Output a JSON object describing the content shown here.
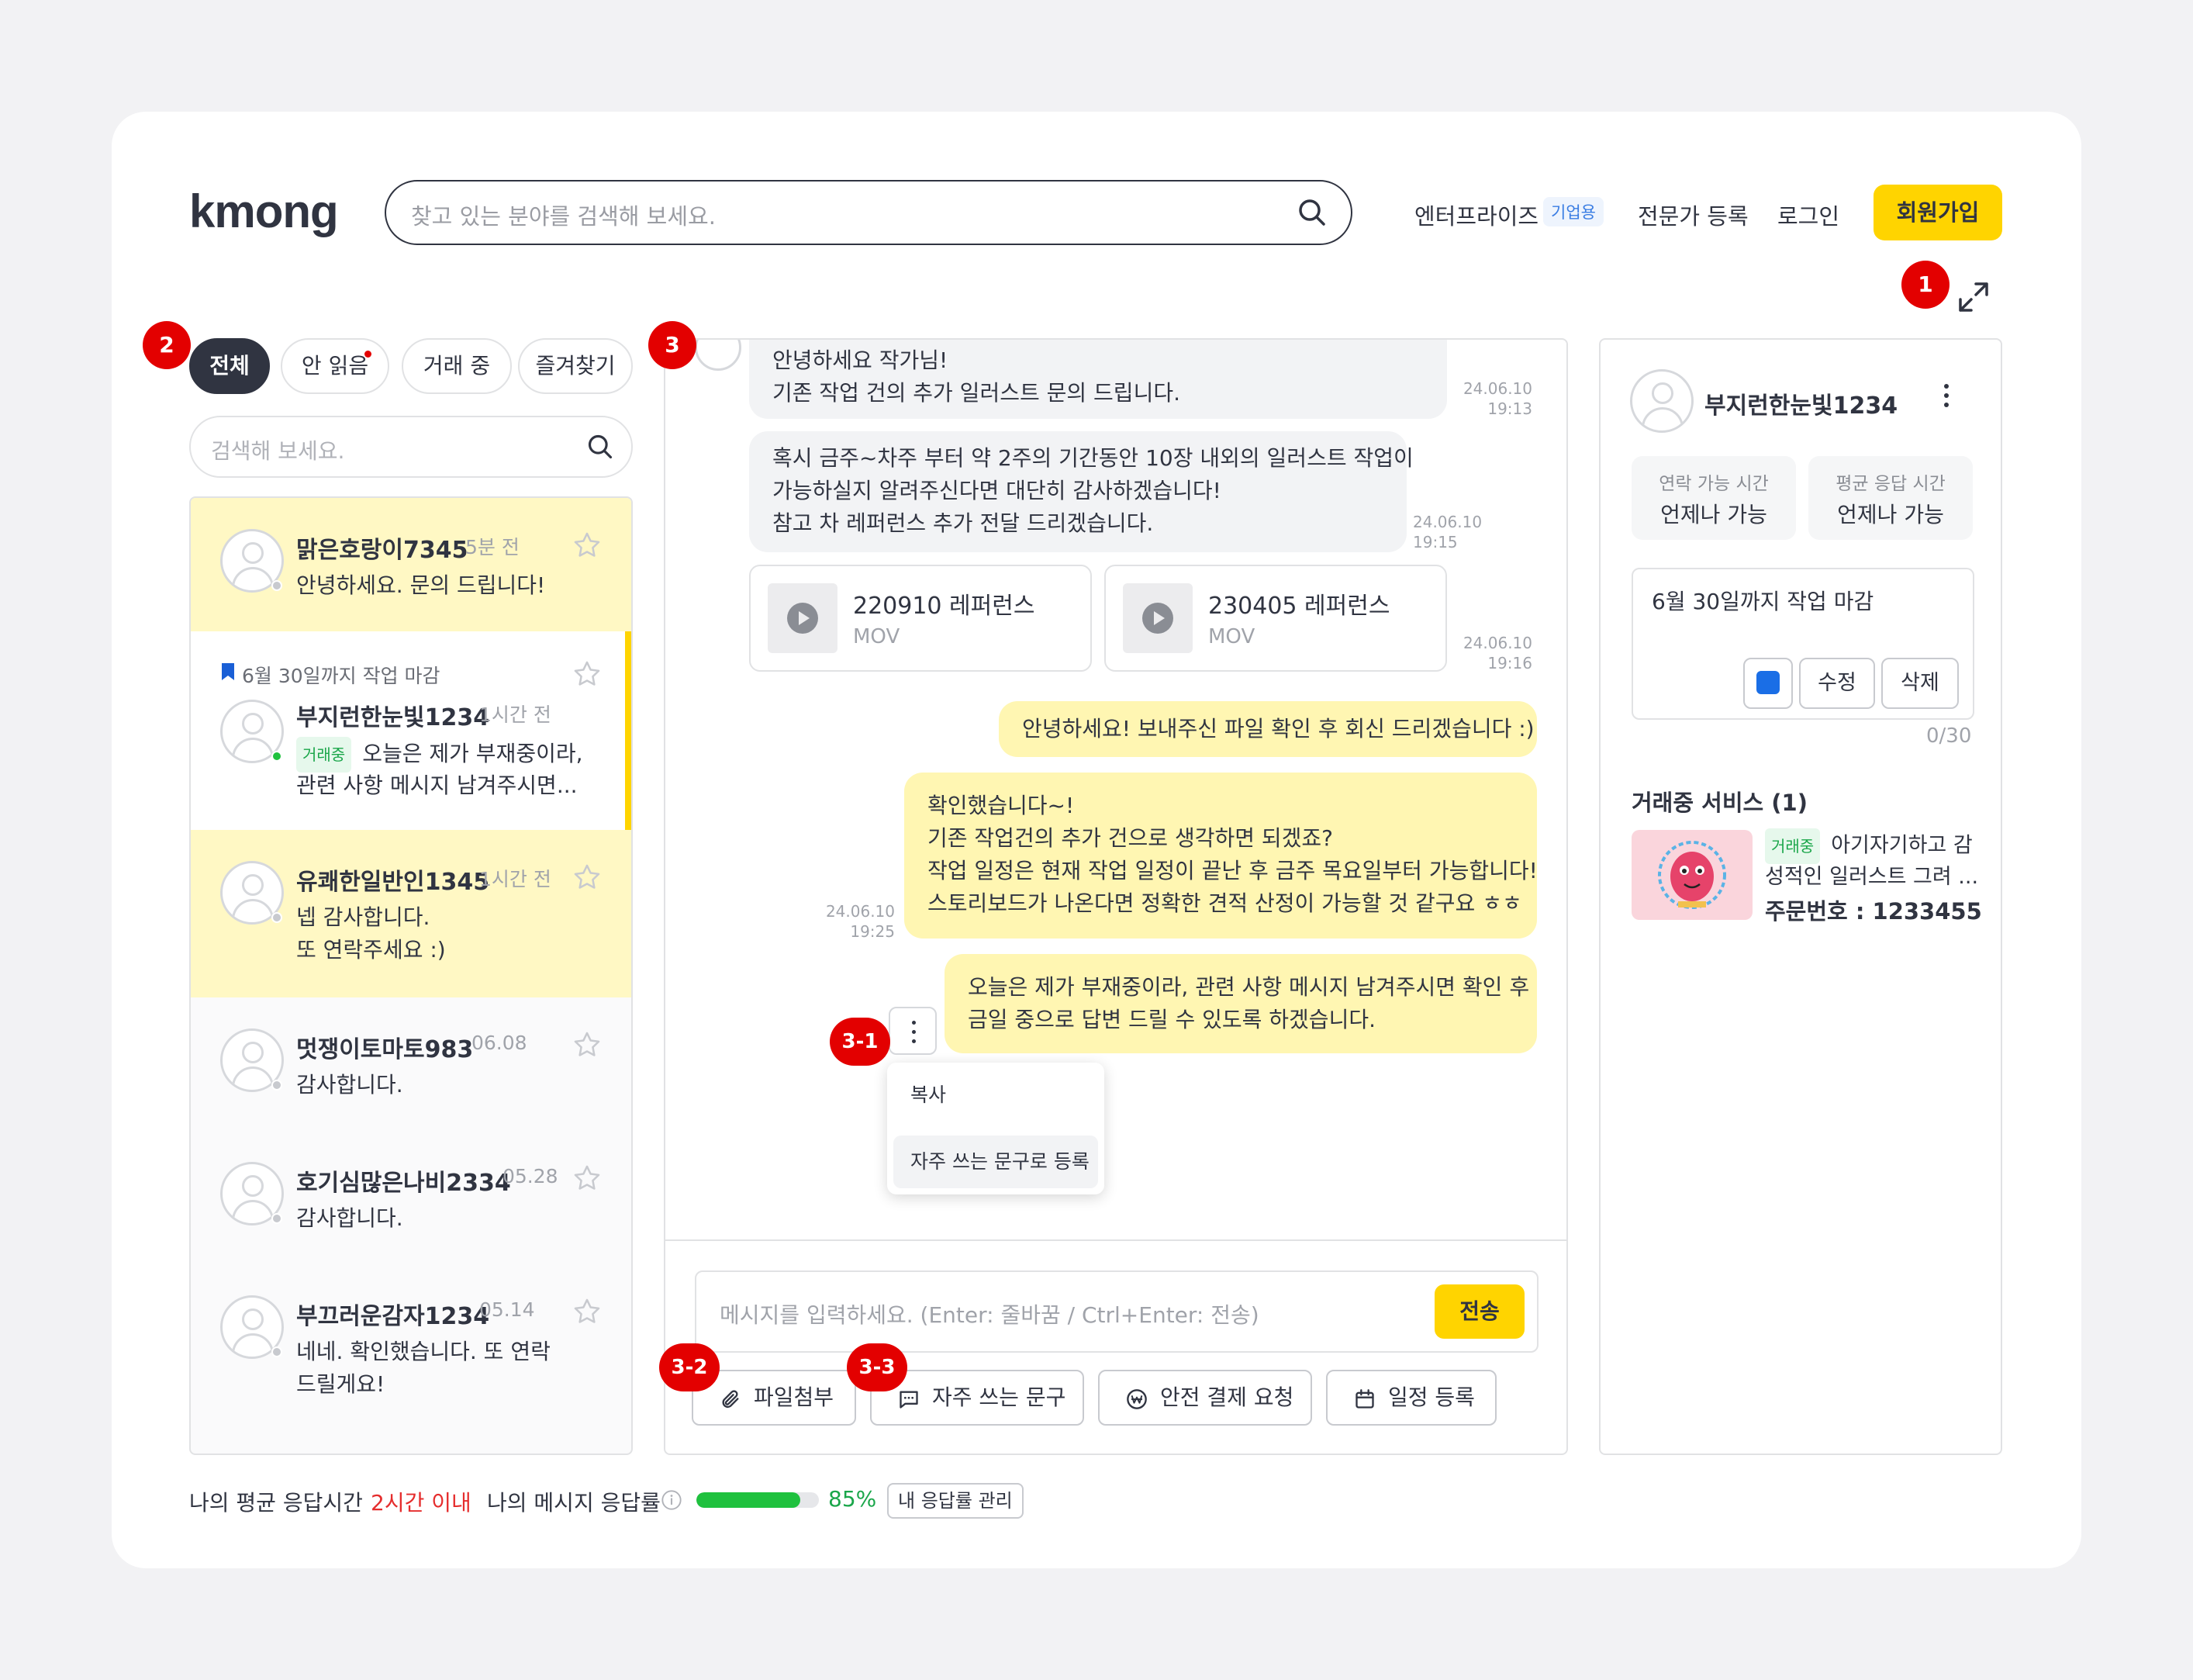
{
  "header": {
    "logo": "kmong",
    "search_placeholder": "찾고 있는 분야를 검색해 보세요.",
    "nav_enterprise": "엔터프라이즈",
    "nav_enterprise_badge": "기업용",
    "nav_expert": "전문가 등록",
    "nav_login": "로그인",
    "nav_signup": "회원가입"
  },
  "markers": {
    "m1": "1",
    "m2": "2",
    "m3": "3",
    "m31": "3-1",
    "m32": "3-2",
    "m33": "3-3"
  },
  "left": {
    "tabs": [
      "전체",
      "안 읽음",
      "거래 중",
      "즐겨찾기"
    ],
    "search_placeholder": "검색해 보세요.",
    "conversations": [
      {
        "name": "맑은호랑이7345",
        "time": "5분 전",
        "lines": [
          "안녕하세요. 문의 드립니다!"
        ]
      },
      {
        "pinned": "6월 30일까지 작업 마감",
        "name": "부지런한눈빛1234",
        "time": "1시간 전",
        "tag": "거래중",
        "lines": [
          "오늘은 제가 부재중이라,",
          "관련 사항 메시지 남겨주시면..."
        ]
      },
      {
        "name": "유쾌한일반인1345",
        "time": "1시간 전",
        "lines": [
          "넵 감사합니다.",
          "또 연락주세요 :)"
        ]
      },
      {
        "name": "멋쟁이토마토983",
        "time": "06.08",
        "lines": [
          "감사합니다."
        ]
      },
      {
        "name": "호기심많은나비2334",
        "time": "05.28",
        "lines": [
          "감사합니다."
        ]
      },
      {
        "name": "부끄러운감자1234",
        "time": "05.14",
        "lines": [
          "네네. 확인했습니다. 또 연락",
          "드릴게요!"
        ]
      }
    ]
  },
  "chat": {
    "messages": [
      {
        "lines": [
          "안녕하세요 작가님!",
          "기존 작업 건의 추가 일러스트 문의 드립니다."
        ],
        "date": "24.06.10",
        "time": "19:13"
      },
      {
        "lines": [
          "혹시 금주~차주 부터 약 2주의 기간동안 10장 내외의 일러스트 작업이",
          "가능하실지 알려주신다면 대단히 감사하겠습니다!",
          "참고 차 레퍼런스 추가 전달 드리겠습니다."
        ],
        "date": "24.06.10",
        "time": "19:15"
      },
      {
        "date": "24.06.10",
        "time": "19:16"
      },
      {
        "lines": [
          "안녕하세요! 보내주신 파일 확인 후 회신 드리겠습니다 :)"
        ]
      },
      {
        "lines": [
          "확인했습니다~!",
          "기존 작업건의 추가 건으로 생각하면 되겠죠?",
          "작업 일정은 현재 작업 일정이 끝난 후 금주 목요일부터 가능합니다!",
          "스토리보드가 나온다면 정확한 견적 산정이 가능할 것 같구요 ㅎㅎ"
        ],
        "date": "24.06.10",
        "time": "19:25"
      },
      {
        "lines": [
          "오늘은 제가 부재중이라, 관련 사항 메시지 남겨주시면 확인 후",
          "금일 중으로 답변 드릴 수 있도록 하겠습니다."
        ]
      }
    ],
    "files": [
      {
        "name": "220910 레퍼런스",
        "type": "MOV"
      },
      {
        "name": "230405 레퍼런스",
        "type": "MOV"
      }
    ],
    "context_menu": [
      "복사",
      "자주 쓰는 문구로 등록"
    ],
    "input_placeholder": "메시지를 입력하세요. (Enter: 줄바꿈 / Ctrl+Enter: 전송)",
    "send": "전송",
    "toolbar": [
      "파일첨부",
      "자주 쓰는 문구",
      "안전 결제 요청",
      "일정 등록"
    ]
  },
  "right": {
    "name": "부지런한눈빛1234",
    "contact_label": "연락 가능 시간",
    "contact_value": "언제나 가능",
    "response_label": "평균 응답 시간",
    "response_value": "언제나 가능",
    "memo": "6월 30일까지 작업 마감",
    "memo_color": "#1a6ee6",
    "memo_edit": "수정",
    "memo_delete": "삭제",
    "memo_count": "0/30",
    "services_title": "거래중 서비스 (1)",
    "service_tag": "거래중",
    "service_line1": "아기자기하고 감",
    "service_line2": "성적인 일러스트 그려 ...",
    "order_label": "주문번호 : 1233455"
  },
  "footer": {
    "avg_label": "나의 평균 응답시간",
    "avg_value": "2시간 이내",
    "rate_label": "나의 메시지 응답률",
    "rate_percent": "85%",
    "rate_fraction": 0.85,
    "manage": "내 응답률 관리"
  },
  "colors": {
    "accent": "#ffd400",
    "marker": "#e30000",
    "highlight": "#fff8c4",
    "green": "#1fc13e"
  }
}
